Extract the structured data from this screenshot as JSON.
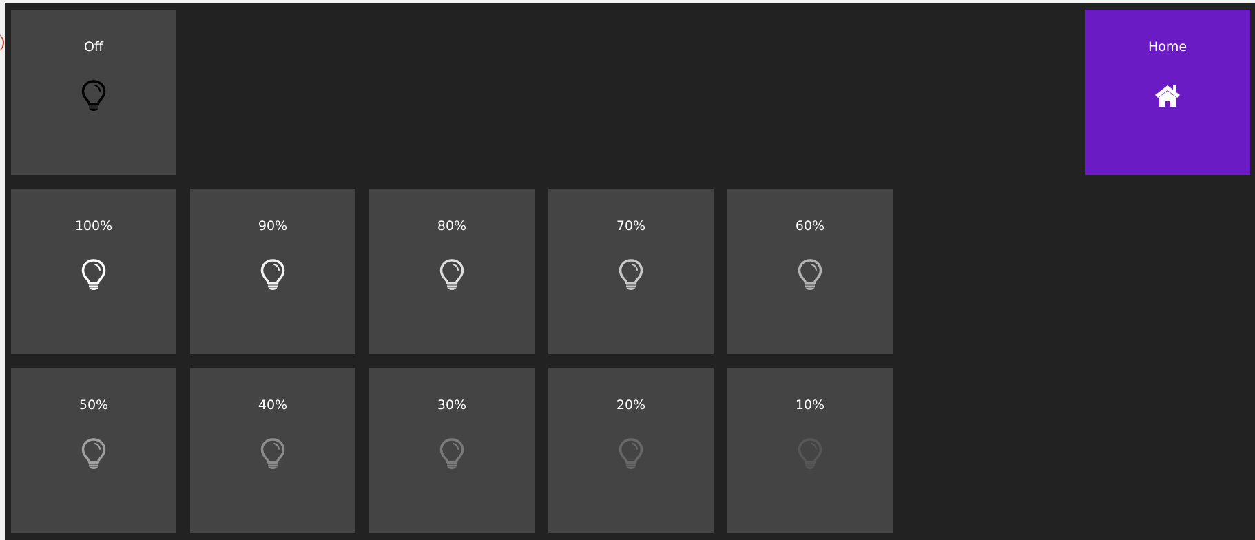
{
  "off_tile": {
    "label": "Off",
    "icon": "bulb-icon",
    "icon_color": "#000000"
  },
  "home_tile": {
    "label": "Home",
    "icon": "home-icon",
    "background": "#6a1bc4"
  },
  "brightness_tiles": [
    {
      "label": "100%",
      "level": 100,
      "icon": "bulb-icon",
      "icon_color": "#ffffff"
    },
    {
      "label": "90%",
      "level": 90,
      "icon": "bulb-icon",
      "icon_color": "#f2f2f2"
    },
    {
      "label": "80%",
      "level": 80,
      "icon": "bulb-icon",
      "icon_color": "#dddddd"
    },
    {
      "label": "70%",
      "level": 70,
      "icon": "bulb-icon",
      "icon_color": "#c8c8c8"
    },
    {
      "label": "60%",
      "level": 60,
      "icon": "bulb-icon",
      "icon_color": "#b3b3b3"
    },
    {
      "label": "50%",
      "level": 50,
      "icon": "bulb-icon",
      "icon_color": "#a0a0a0"
    },
    {
      "label": "40%",
      "level": 40,
      "icon": "bulb-icon",
      "icon_color": "#8c8c8c"
    },
    {
      "label": "30%",
      "level": 30,
      "icon": "bulb-icon",
      "icon_color": "#7a7a7a"
    },
    {
      "label": "20%",
      "level": 20,
      "icon": "bulb-icon",
      "icon_color": "#686868"
    },
    {
      "label": "10%",
      "level": 10,
      "icon": "bulb-icon",
      "icon_color": "#575757"
    }
  ]
}
